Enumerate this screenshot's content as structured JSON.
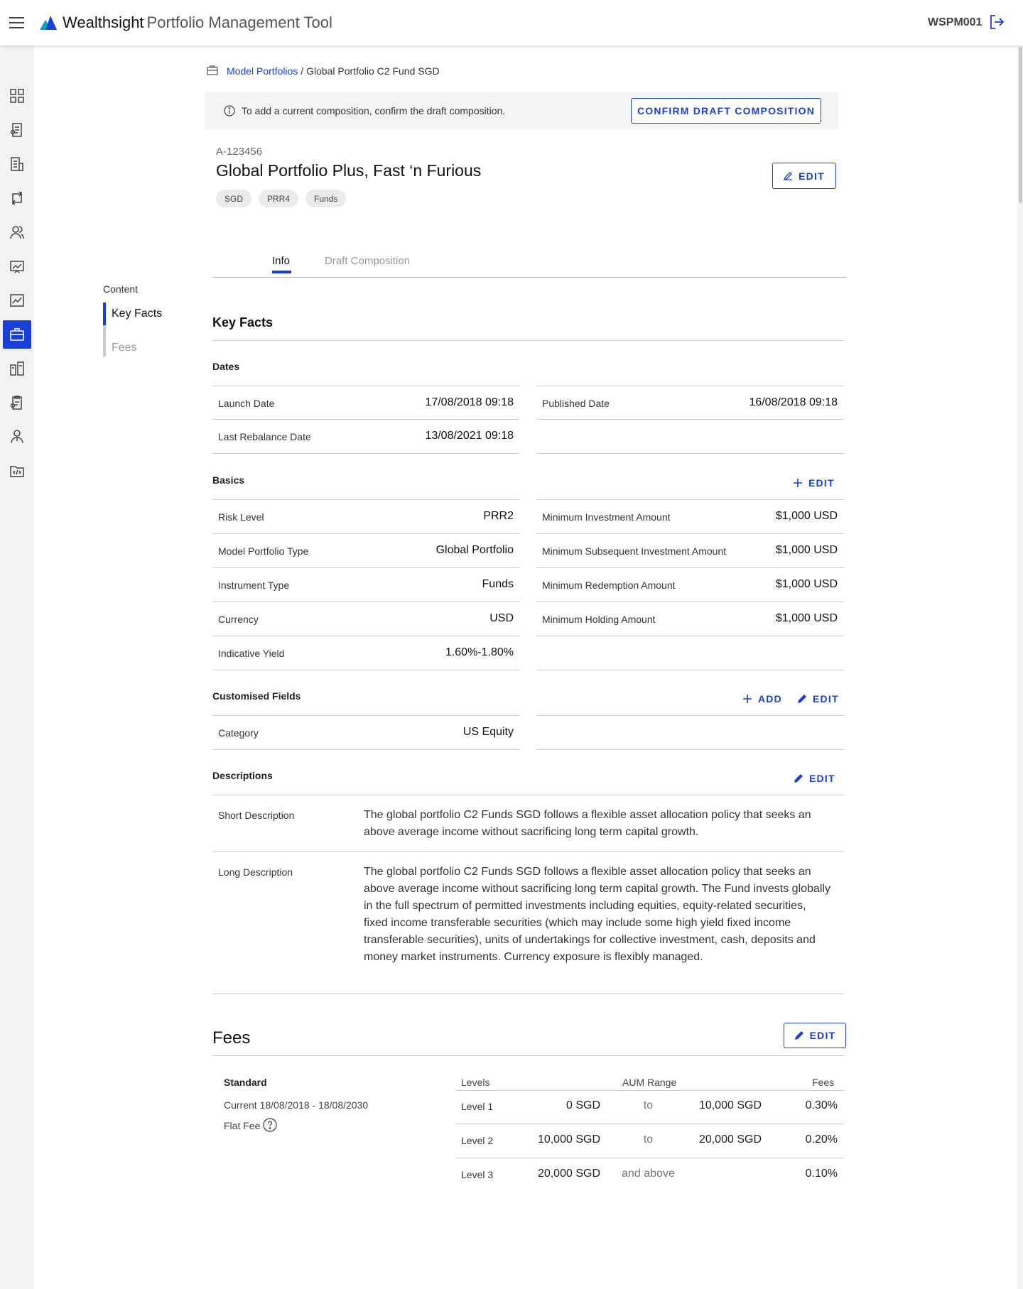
{
  "header": {
    "brand": "Wealthsight",
    "product": "Portfolio Management Tool",
    "user": "WSPM001"
  },
  "rail_icons": [
    "dashboard-icon",
    "document-list-icon",
    "report-icon",
    "exchange-icon",
    "users-icon",
    "presentation-chart-icon",
    "line-chart-icon",
    "briefcase-icon",
    "fund-comparison-icon",
    "clipboard-icon",
    "advisor-icon",
    "code-folder-icon"
  ],
  "breadcrumb": {
    "link": "Model Portfolios",
    "separator": "/",
    "current": "Global Portfolio C2 Fund SGD"
  },
  "banner": {
    "message": "To add a current composition, confirm the draft composition.",
    "button": "CONFIRM DRAFT COMPOSITION"
  },
  "portfolio": {
    "id": "A-123456",
    "title": "Global Portfolio Plus, Fast ‘n Furious",
    "tags": [
      "SGD",
      "PRR4",
      "Funds"
    ],
    "edit": "EDIT"
  },
  "tabs": {
    "info": "Info",
    "draft": "Draft Composition"
  },
  "toc": {
    "heading": "Content",
    "key_facts": "Key Facts",
    "fees": "Fees"
  },
  "key_facts": {
    "title": "Key Facts",
    "dates": {
      "title": "Dates",
      "launch_label": "Launch Date",
      "launch_value": "17/08/2018 09:18",
      "published_label": "Published Date",
      "published_value": "16/08/2018 09:18",
      "rebalance_label": "Last Rebalance Date",
      "rebalance_value": "13/08/2021 09:18"
    },
    "basics": {
      "title": "Basics",
      "edit": "EDIT",
      "left": [
        {
          "label": "Risk Level",
          "value": "PRR2"
        },
        {
          "label": "Model Portfolio Type",
          "value": "Global Portfolio"
        },
        {
          "label": "Instrument Type",
          "value": "Funds"
        },
        {
          "label": "Currency",
          "value": "USD"
        },
        {
          "label": "Indicative Yield",
          "value": "1.60%-1.80%"
        }
      ],
      "right": [
        {
          "label": "Minimum Investment Amount",
          "value": "$1,000 USD"
        },
        {
          "label": "Minimum Subsequent Investment Amount",
          "value": "$1,000 USD"
        },
        {
          "label": "Minimum Redemption Amount",
          "value": "$1,000 USD"
        },
        {
          "label": "Minimum Holding Amount",
          "value": "$1,000 USD"
        }
      ]
    },
    "custom": {
      "title": "Customised Fields",
      "add": "ADD",
      "edit": "EDIT",
      "category_label": "Category",
      "category_value": "US Equity"
    },
    "descriptions": {
      "title": "Descriptions",
      "edit": "EDIT",
      "short_label": "Short Description",
      "short_text": "The global portfolio C2 Funds SGD follows a flexible asset allocation policy that seeks an above average income without sacrificing long term capital growth.",
      "long_label": "Long Description",
      "long_text": "The global portfolio C2 Funds SGD follows a flexible asset allocation policy that seeks an above average income without sacrificing long term capital growth. The Fund invests globally in the full spectrum of permitted investments including equities, equity-related securities, fixed income transferable securities (which may include some high yield fixed income transferable securities), units of undertakings for collective investment, cash, deposits and money market instruments. Currency exposure is flexibly managed."
    }
  },
  "fees": {
    "title": "Fees",
    "edit": "EDIT",
    "plan": "Standard",
    "period": "Current 18/08/2018 - 18/08/2030",
    "type": "Flat Fee",
    "columns": {
      "levels": "Levels",
      "range": "AUM Range",
      "fees": "Fees"
    },
    "rows": [
      {
        "level": "Level 1",
        "from": "0 SGD",
        "sep": "to",
        "to": "10,000 SGD",
        "fee": "0.30%"
      },
      {
        "level": "Level 2",
        "from": "10,000 SGD",
        "sep": "to",
        "to": "20,000 SGD",
        "fee": "0.20%"
      },
      {
        "level": "Level 3",
        "from": "20,000 SGD",
        "sep": "and above",
        "to": "",
        "fee": "0.10%"
      }
    ]
  },
  "colors": {
    "accent": "#1a3fd6",
    "rail_bg": "#f2f2f2",
    "banner_bg": "#f4f4f4"
  }
}
